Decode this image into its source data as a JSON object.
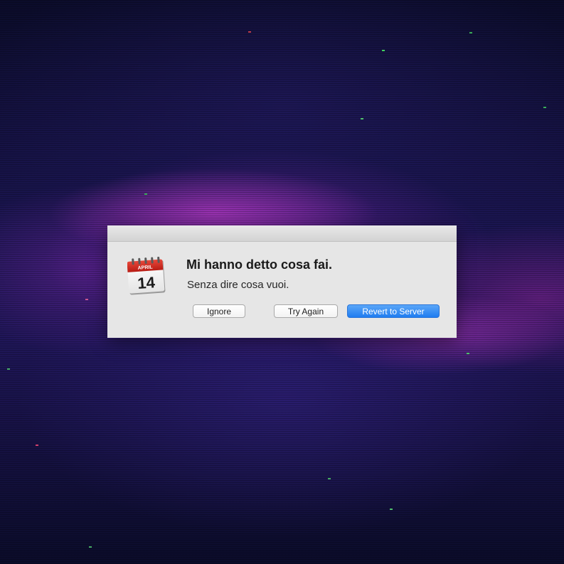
{
  "dialog": {
    "title": "Mi hanno detto cosa fai.",
    "message": "Senza dire cosa vuoi.",
    "icon": "calendar-icon",
    "icon_month": "APRIL",
    "icon_day": "14"
  },
  "buttons": {
    "ignore_label": "Ignore",
    "try_again_label": "Try Again",
    "revert_label": "Revert to Server"
  },
  "colors": {
    "primary_button": "#1f7cf0",
    "dialog_background": "#e6e6e6",
    "calendar_red": "#d32a1f"
  }
}
